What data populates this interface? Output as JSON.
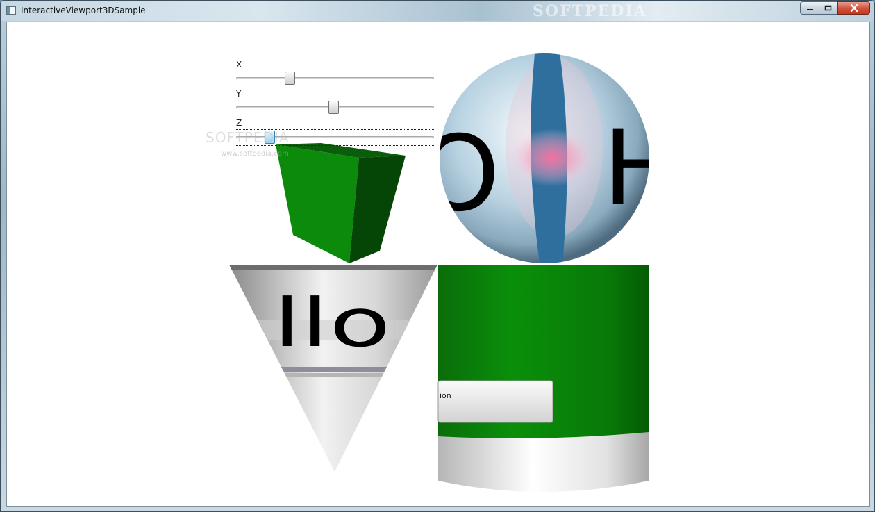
{
  "window": {
    "title": "InteractiveViewport3DSample",
    "watermark": "SOFTPEDIA"
  },
  "panel": {
    "sliders": [
      {
        "label": "X",
        "value": 0.27
      },
      {
        "label": "Y",
        "value": 0.49
      },
      {
        "label": "Z",
        "value": 0.17
      }
    ],
    "watermark": "SOFTPEDIA",
    "watermark_url": "www.softpedia.com"
  },
  "scene": {
    "cone_text": "llo",
    "sphere_text_left": "O",
    "sphere_text_right": "H",
    "cylinder_button_text": "ion",
    "colors": {
      "box": "#0a8a0a",
      "cylinder": "#008000",
      "sphere_stripe": "#2f6f9e",
      "highlight": "#ff6fa0"
    }
  }
}
